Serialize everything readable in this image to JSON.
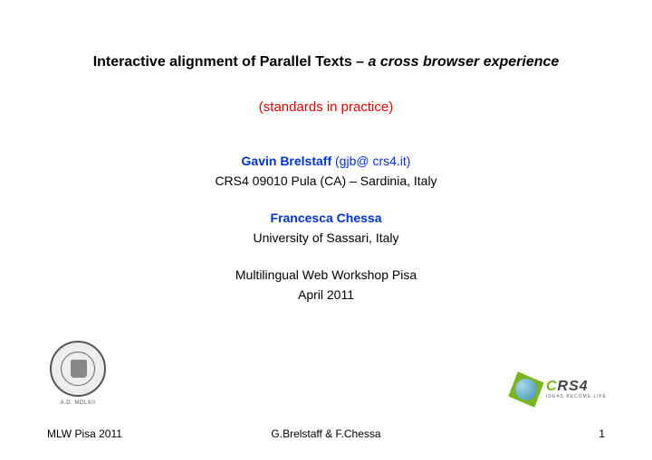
{
  "title": {
    "main": "Interactive alignment of Parallel Texts",
    "separator": " – ",
    "sub": "a cross browser experience"
  },
  "subtitle": "(standards in practice)",
  "authors": [
    {
      "name": "Gavin Brelstaff",
      "email": "(gjb@ crs4.it)",
      "affiliation": "CRS4 09010 Pula (CA) – Sardinia, Italy"
    },
    {
      "name": "Francesca Chessa",
      "email": "",
      "affiliation": "University of Sassari, Italy"
    }
  ],
  "workshop": {
    "name": "Multilingual Web Workshop Pisa",
    "date": "April 2011"
  },
  "seal": {
    "caption": "A.D. MDLXII"
  },
  "crs4": {
    "brand_first": "C",
    "brand_rest": "RS4",
    "tagline": "IDEAS BECOME LIFE"
  },
  "footer": {
    "left": "MLW Pisa 2011",
    "center": "G.Brelstaff & F.Chessa",
    "right": "1"
  }
}
